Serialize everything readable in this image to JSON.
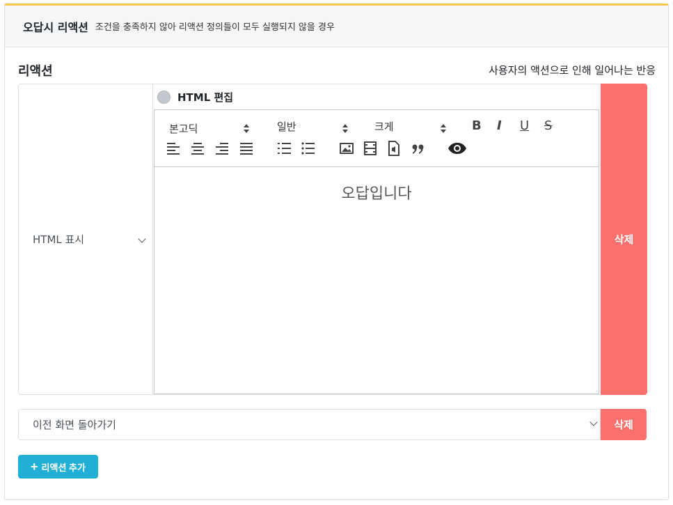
{
  "header": {
    "title": "오답시 리액션",
    "description": "조건을 충족하지 않아 리액션 정의들이 모두 실행되지 않을 경우"
  },
  "section": {
    "title": "리액션",
    "hint": "사용자의 액션으로 인해 일어나는 반응"
  },
  "action1": {
    "type_label": "HTML 표시",
    "html_edit_label": "HTML 편집",
    "toolbar": {
      "font": "본고딕",
      "style": "일반",
      "size": "크게",
      "bold": "B",
      "italic": "I",
      "underline": "U",
      "strike": "S"
    },
    "editor_content": "오답입니다",
    "delete_label": "삭제"
  },
  "action2": {
    "select_label": "이전 화면 돌아가기",
    "delete_label": "삭제"
  },
  "add_button": {
    "icon": "+",
    "label": "리액션 추가"
  },
  "colors": {
    "accent_top": "#f6c64a",
    "delete": "#fb6f6d",
    "add": "#22afd6"
  }
}
